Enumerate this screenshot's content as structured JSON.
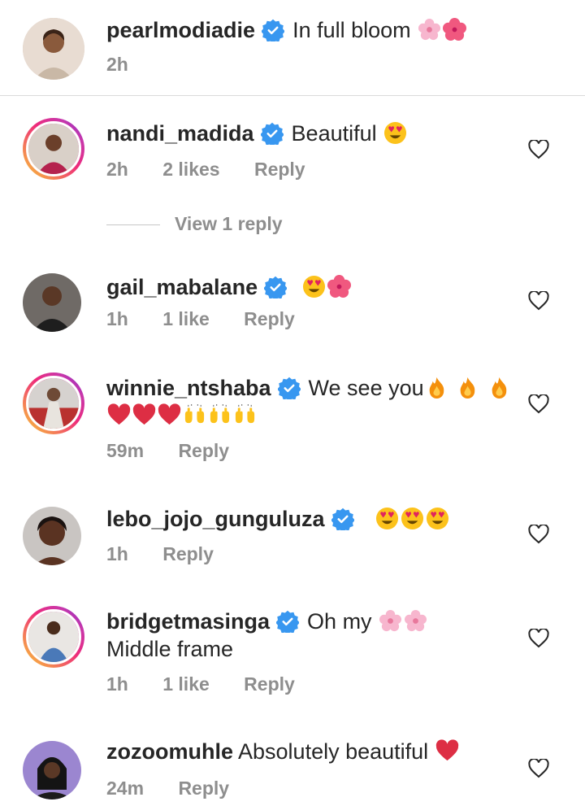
{
  "caption": {
    "username": "pearlmodiadie",
    "text": "In full bloom",
    "emojis": [
      "cherry-blossom",
      "hibiscus"
    ],
    "time": "2h"
  },
  "comments": [
    {
      "username": "nandi_madida",
      "text": "Beautiful",
      "emojis": [
        "heart-eyes"
      ],
      "time": "2h",
      "likes": "2 likes",
      "reply": "Reply",
      "view_replies": "View 1 reply"
    },
    {
      "username": "gail_mabalane",
      "text": "",
      "emojis": [
        "heart-eyes",
        "hibiscus"
      ],
      "time": "1h",
      "likes": "1 like",
      "reply": "Reply"
    },
    {
      "username": "winnie_ntshaba",
      "text": "We see you",
      "emojis": [
        "fire",
        "fire",
        "fire"
      ],
      "line2_emojis": [
        "red-heart",
        "red-heart",
        "red-heart",
        "raising-hands",
        "raising-hands",
        "raising-hands"
      ],
      "time": "59m",
      "reply": "Reply"
    },
    {
      "username": "lebo_jojo_gunguluza",
      "text": "",
      "emojis": [
        "heart-eyes",
        "heart-eyes",
        "heart-eyes"
      ],
      "time": "1h",
      "reply": "Reply"
    },
    {
      "username": "bridgetmasinga",
      "text": "Oh my",
      "emojis": [
        "cherry-blossom",
        "cherry-blossom"
      ],
      "line2": "Middle frame",
      "time": "1h",
      "likes": "1 like",
      "reply": "Reply"
    },
    {
      "username": "zozoomuhle",
      "text": "Absolutely beautiful",
      "emojis": [
        "red-heart"
      ],
      "time": "24m",
      "reply": "Reply"
    }
  ],
  "colors": {
    "verified": "#3897f0",
    "meta": "#8e8e8e",
    "text": "#262626"
  }
}
